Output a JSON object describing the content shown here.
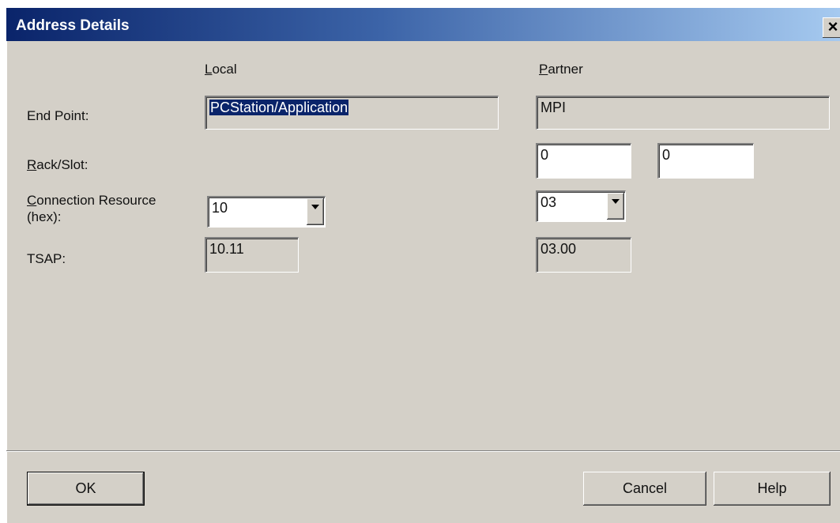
{
  "window": {
    "title": "Address Details",
    "close_glyph": "×"
  },
  "columns": {
    "local_prefix": "L",
    "local_rest": "ocal",
    "partner_prefix": "P",
    "partner_rest": "artner"
  },
  "rows": {
    "end_point_label": "End Point:",
    "rack_slot_prefix": "R",
    "rack_slot_rest": "ack/Slot:",
    "conn_res_prefix": "C",
    "conn_res_rest": "onnection Resource",
    "conn_res_line2": "(hex):",
    "tsap_label": "TSAP:"
  },
  "local": {
    "end_point": "PCStation/Application",
    "connection_resource": "10",
    "tsap": "10.11"
  },
  "partner": {
    "end_point": "MPI",
    "rack": "0",
    "slot": "0",
    "connection_resource": "03",
    "tsap": "03.00"
  },
  "buttons": {
    "ok": "OK",
    "cancel": "Cancel",
    "help": "Help"
  },
  "colors": {
    "dialog_bg": "#d4d0c8",
    "titlebar_start": "#0a246a",
    "titlebar_end": "#a6caf0",
    "selection_bg": "#0a246a"
  }
}
